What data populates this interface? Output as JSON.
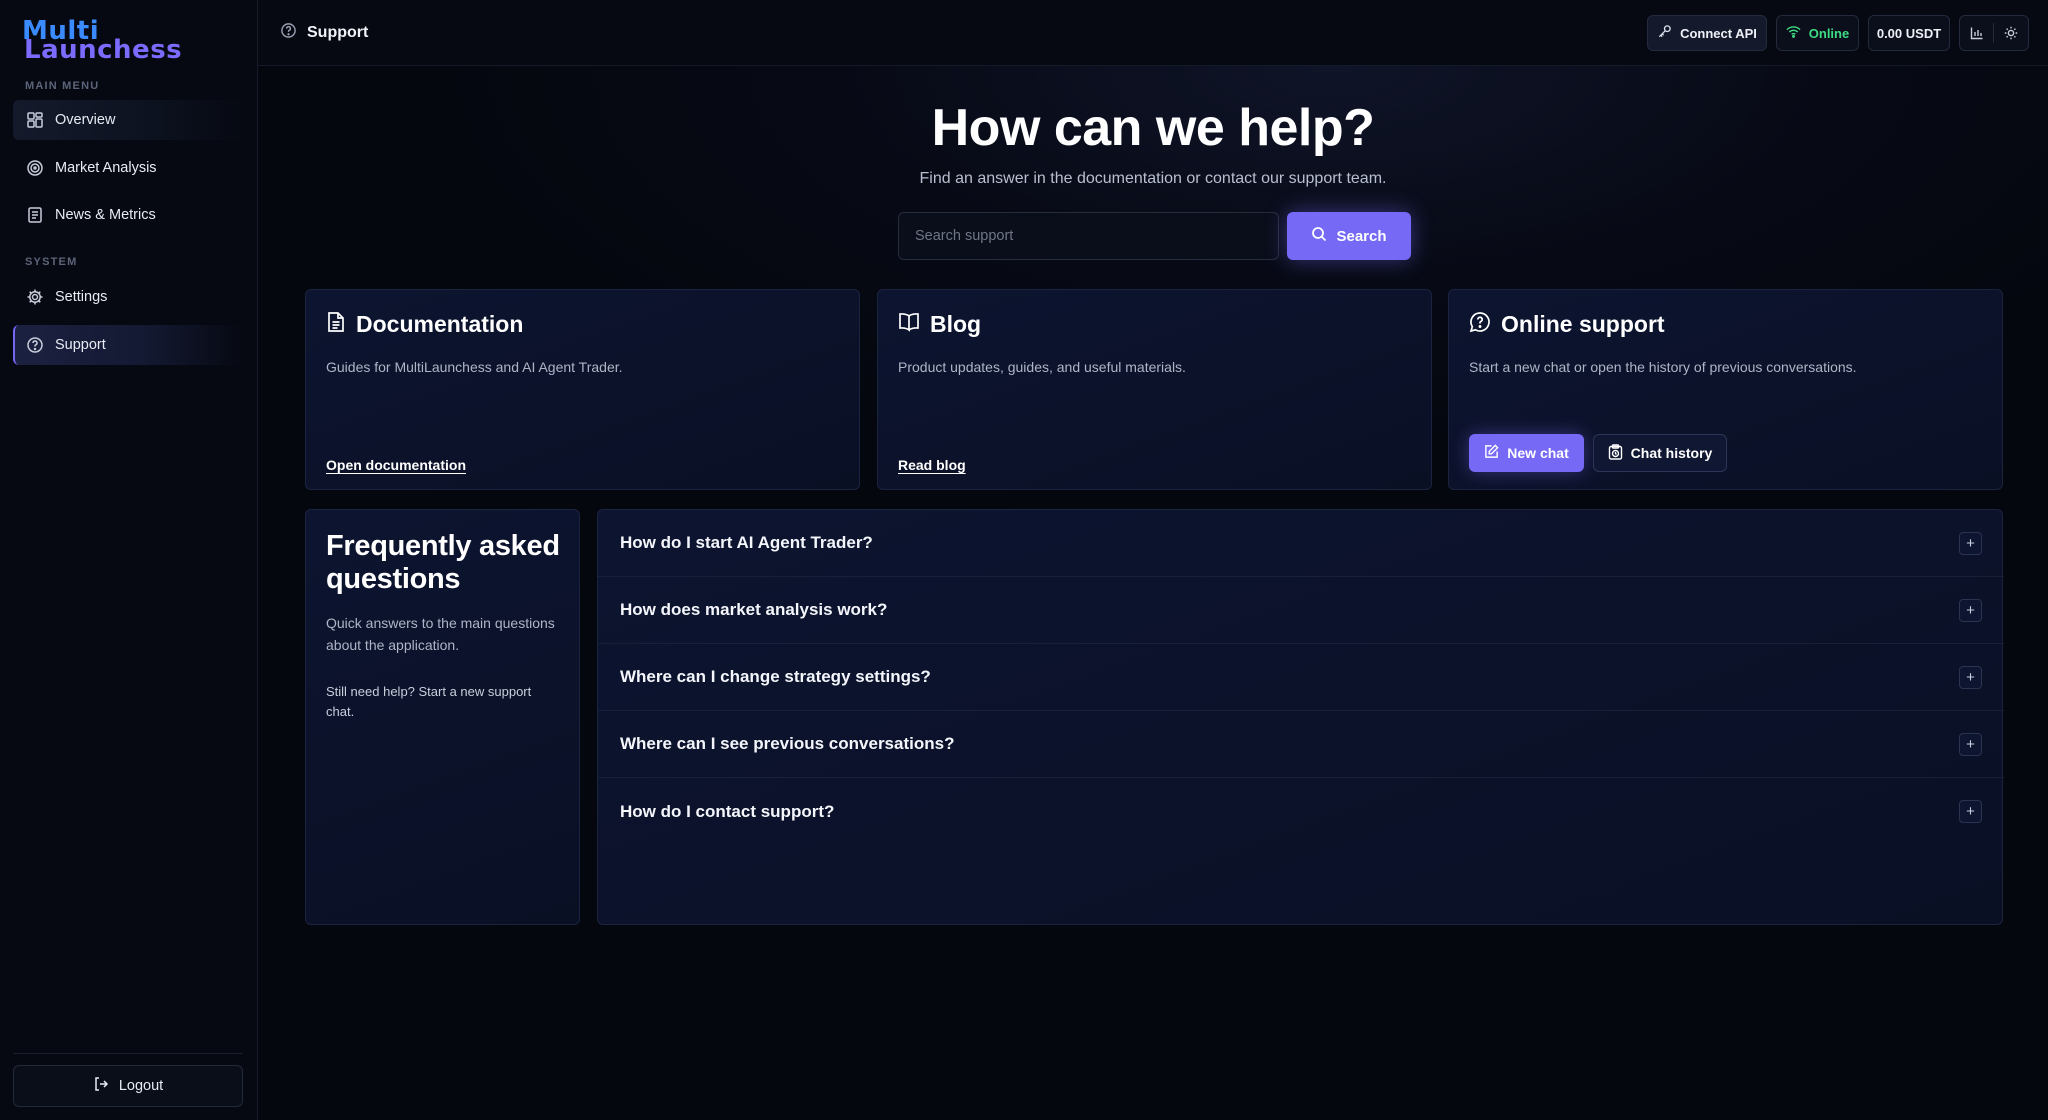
{
  "sidebar": {
    "logo": {
      "line1": "Multi",
      "line2": "Launchess"
    },
    "main_menu_label": "MAIN MENU",
    "system_label": "SYSTEM",
    "items": [
      {
        "label": "Overview",
        "icon": "grid-icon"
      },
      {
        "label": "Market Analysis",
        "icon": "target-icon"
      },
      {
        "label": "News & Metrics",
        "icon": "newspaper-icon"
      },
      {
        "label": "Settings",
        "icon": "gear-icon"
      },
      {
        "label": "Support",
        "icon": "help-circle-icon",
        "active": true
      }
    ],
    "logout_label": "Logout"
  },
  "header": {
    "title": "Support",
    "connect_api_label": "Connect API",
    "status_label": "Online",
    "balance_label": "0.00 USDT",
    "status_color": "#3ddc84",
    "accent_color": "#7569f6"
  },
  "hero": {
    "title": "How can we help?",
    "subtitle": "Find an answer in the documentation or contact our support team.",
    "search_placeholder": "Search support",
    "search_button": "Search"
  },
  "cards": {
    "documentation": {
      "title": "Documentation",
      "description": "Guides for MultiLaunchess and AI Agent Trader.",
      "link": "Open documentation"
    },
    "blog": {
      "title": "Blog",
      "description": "Product updates, guides, and useful materials.",
      "link": "Read blog"
    },
    "online_support": {
      "title": "Online support",
      "description": "Start a new chat or open the history of previous conversations.",
      "new_chat": "New chat",
      "chat_history": "Chat history"
    }
  },
  "faq": {
    "title": "Frequently asked questions",
    "subtitle": "Quick answers to the main questions about the application.",
    "note": "Still need help? Start a new support chat.",
    "items": [
      {
        "question": "How do I start AI Agent Trader?"
      },
      {
        "question": "How does market analysis work?"
      },
      {
        "question": "Where can I change strategy settings?"
      },
      {
        "question": "Where can I see previous conversations?"
      },
      {
        "question": "How do I contact support?"
      }
    ],
    "expand_symbol": "+"
  }
}
